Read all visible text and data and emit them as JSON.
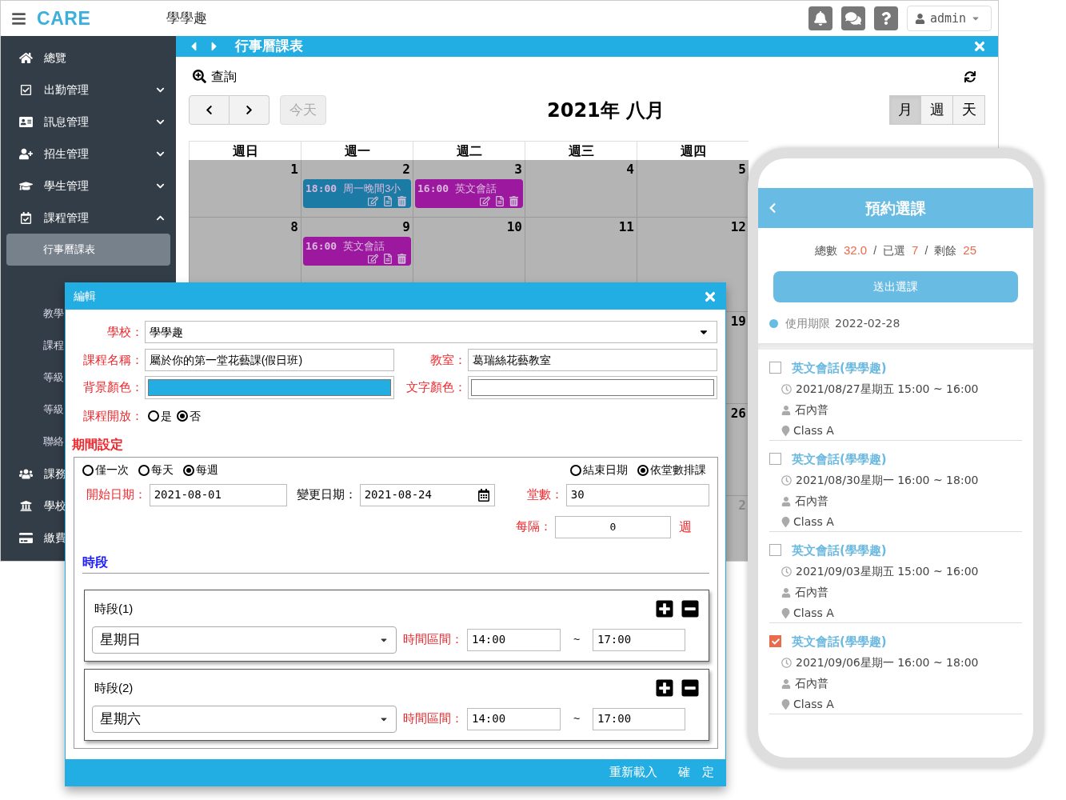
{
  "header": {
    "brand": "CARE",
    "school": "學學趣",
    "user": "admin"
  },
  "sidebar": {
    "items": [
      {
        "label": "總覽",
        "kind": "link"
      },
      {
        "label": "出勤管理",
        "kind": "group",
        "expanded": false
      },
      {
        "label": "訊息管理",
        "kind": "group",
        "expanded": false
      },
      {
        "label": "招生管理",
        "kind": "group",
        "expanded": false
      },
      {
        "label": "學生管理",
        "kind": "group",
        "expanded": false
      },
      {
        "label": "課程管理",
        "kind": "group",
        "expanded": true,
        "children": [
          {
            "label": "行事曆課表",
            "selected": true
          },
          {
            "label": "教學",
            "selected": false
          },
          {
            "label": "課程",
            "selected": false
          },
          {
            "label": "等級",
            "selected": false
          },
          {
            "label": "等級",
            "selected": false
          },
          {
            "label": "聯絡",
            "selected": false
          }
        ]
      },
      {
        "label": "課務",
        "kind": "link"
      },
      {
        "label": "學校",
        "kind": "link"
      },
      {
        "label": "繳費",
        "kind": "link"
      }
    ]
  },
  "panel": {
    "title": "行事曆課表",
    "query": "查詢",
    "today": "今天",
    "calendar_title": "2021年 八月",
    "views": [
      {
        "label": "月",
        "selected": true
      },
      {
        "label": "週",
        "selected": false
      },
      {
        "label": "天",
        "selected": false
      }
    ],
    "weekdays": [
      "週日",
      "週一",
      "週二",
      "週三",
      "週四"
    ],
    "weeks": [
      {
        "days": [
          {
            "day": "1",
            "other_month": false
          },
          {
            "day": "2",
            "other_month": false,
            "events": [
              {
                "time": "18:00",
                "title": "周一晚間3小",
                "color": "#1b7ba5"
              }
            ]
          },
          {
            "day": "3",
            "other_month": false,
            "events": [
              {
                "time": "16:00",
                "title": "英文會話",
                "color": "#9c199f"
              }
            ]
          },
          {
            "day": "4",
            "other_month": false
          },
          {
            "day": "5",
            "other_month": false
          }
        ]
      },
      {
        "days": [
          {
            "day": "8",
            "other_month": false
          },
          {
            "day": "9",
            "other_month": false,
            "events": [
              {
                "time": "16:00",
                "title": "英文會話",
                "color": "#9c199f"
              }
            ]
          },
          {
            "day": "10",
            "other_month": false
          },
          {
            "day": "11",
            "other_month": false
          },
          {
            "day": "12",
            "other_month": false
          }
        ]
      },
      {
        "days": [
          {
            "day": "19",
            "other_month": false
          }
        ]
      },
      {
        "days": [
          {
            "day": "26",
            "other_month": false
          }
        ]
      },
      {
        "days": [
          {
            "day": "2",
            "other_month": true
          }
        ]
      }
    ]
  },
  "dialog": {
    "title": "編輯",
    "school": {
      "label": "學校：",
      "value": "學學趣"
    },
    "course_name": {
      "label": "課程名稱：",
      "value": "屬於你的第一堂花藝課(假日班)"
    },
    "classroom": {
      "label": "教室：",
      "value": "葛瑞絲花藝教室"
    },
    "background_color": {
      "label": "背景顏色："
    },
    "text_color": {
      "label": "文字顏色："
    },
    "open": {
      "label": "課程開放：",
      "options": [
        {
          "label": "是",
          "selected": false
        },
        {
          "label": "否",
          "selected": true
        }
      ]
    },
    "period_title": "期間設定",
    "frequency": [
      {
        "label": "僅一次",
        "selected": false
      },
      {
        "label": "每天",
        "selected": false
      },
      {
        "label": "每週",
        "selected": true
      }
    ],
    "end_mode": [
      {
        "label": "結束日期",
        "selected": false
      },
      {
        "label": "依堂數排課",
        "selected": true
      }
    ],
    "start_date": {
      "label": "開始日期：",
      "value": "2021-08-01"
    },
    "change_date": {
      "label": "變更日期：",
      "value": "2021-08-24"
    },
    "count": {
      "label": "堂數：",
      "value": "30"
    },
    "interval": {
      "label": "每隔：",
      "value": "0",
      "unit": "週"
    },
    "slots_title": "時段",
    "slots": [
      {
        "title": "時段(1)",
        "day": "星期日",
        "range_label": "時間區間：",
        "from": "14:00",
        "sep": "~",
        "to": "17:00"
      },
      {
        "title": "時段(2)",
        "day": "星期六",
        "range_label": "時間區間：",
        "from": "14:00",
        "sep": "~",
        "to": "17:00"
      }
    ],
    "buttons": [
      "重新載入",
      "確　定"
    ]
  },
  "phone": {
    "title": "預約選課",
    "stats": [
      {
        "label": "總數",
        "value": "32.0"
      },
      {
        "separator": "/",
        "label": "已選",
        "value": "7"
      },
      {
        "separator": "/",
        "label": "剩餘",
        "value": "25"
      }
    ],
    "submit": "送出選課",
    "validity_label": "使用期限",
    "validity": "2022-02-28",
    "courses": [
      {
        "title": "英文會話(學學趣)",
        "time": "2021/08/27星期五 15:00 ~ 16:00",
        "teacher": "石內普",
        "room": "Class A",
        "checked": false
      },
      {
        "title": "英文會話(學學趣)",
        "time": "2021/08/30星期一 16:00 ~ 18:00",
        "teacher": "石內普",
        "room": "Class A",
        "checked": false
      },
      {
        "title": "英文會話(學學趣)",
        "time": "2021/09/03星期五 15:00 ~ 16:00",
        "teacher": "石內普",
        "room": "Class A",
        "checked": false
      },
      {
        "title": "英文會話(學學趣)",
        "time": "2021/09/06星期一 16:00 ~ 18:00",
        "teacher": "石內普",
        "room": "Class A",
        "checked": true
      }
    ]
  }
}
